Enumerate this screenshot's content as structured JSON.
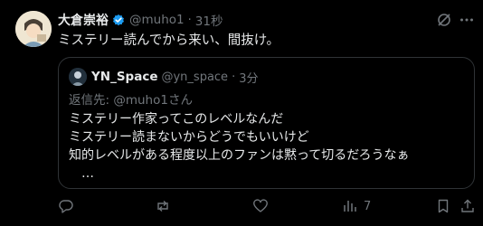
{
  "post": {
    "author_name": "大倉崇裕",
    "handle": "@muho1",
    "time": "31秒",
    "text": "ミステリー読んでから来い、間抜け。"
  },
  "quoted": {
    "author_name": "YN_Space",
    "handle": "@yn_space",
    "time": "3分",
    "replying_to": "返信先: @muho1さん",
    "lines": [
      "ミステリー作家ってこのレベルなんだ",
      "ミステリー読まないからどうでもいいけど",
      "知的レベルがある程度以上のファンは黙って切るだろうなぁ",
      "…"
    ]
  },
  "actions": {
    "views_count": "7"
  },
  "colors": {
    "background": "#000000",
    "text": "#e7e9ea",
    "muted": "#71767b",
    "border": "#2f3336",
    "verified": "#1d9bf0"
  }
}
